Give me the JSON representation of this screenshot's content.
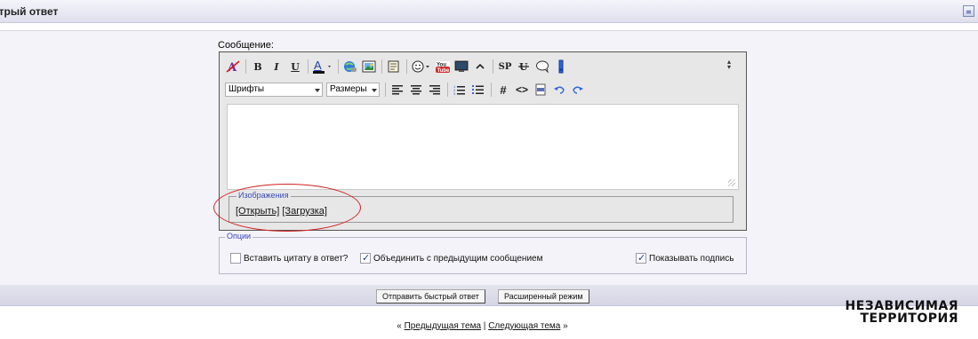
{
  "header": {
    "title": "стрый ответ"
  },
  "editor": {
    "message_label": "Сообщение:",
    "font_select": "Шрифты",
    "size_select": "Размеры",
    "toolbar_row1": [
      {
        "name": "remove-format-icon",
        "label": "A"
      },
      {
        "name": "bold-icon",
        "label": "B"
      },
      {
        "name": "italic-icon",
        "label": "I"
      },
      {
        "name": "underline-icon",
        "label": "U"
      },
      {
        "name": "text-color-icon",
        "label": "A"
      },
      {
        "name": "link-icon",
        "label": ""
      },
      {
        "name": "image-icon",
        "label": ""
      },
      {
        "name": "quote-icon",
        "label": ""
      },
      {
        "name": "smiley-icon",
        "label": "☺"
      },
      {
        "name": "youtube-icon",
        "label": "You"
      },
      {
        "name": "video-icon",
        "label": ""
      },
      {
        "name": "hide-icon",
        "label": "^"
      },
      {
        "name": "spoiler-icon",
        "label": "SP"
      },
      {
        "name": "strike-icon",
        "label": "U"
      },
      {
        "name": "bubble-icon",
        "label": "○"
      },
      {
        "name": "exclamation-icon",
        "label": "!"
      }
    ],
    "toolbar_row2_icons": [
      "align-left-icon",
      "align-center-icon",
      "align-right-icon",
      "ordered-list-icon",
      "unordered-list-icon",
      "hash-icon",
      "code-icon",
      "php-icon",
      "undo-icon",
      "redo-icon"
    ],
    "images_legend": "Изображения",
    "images_open": "[Открыть]",
    "images_upload": "[Загрузка]"
  },
  "options": {
    "legend": "Опции",
    "quote": {
      "label": "Вставить цитату в ответ?",
      "checked": false
    },
    "merge": {
      "label": "Объединить с предыдущим сообщением",
      "checked": true
    },
    "signature": {
      "label": "Показывать подпись",
      "checked": true
    }
  },
  "buttons": {
    "quick_reply": "Отправить быстрый ответ",
    "advanced": "Расширенный режим"
  },
  "nav": {
    "prev_prefix": "«",
    "prev": "Предыдущая тема",
    "separator": "|",
    "next": "Следующая тема",
    "next_suffix": "»"
  },
  "brand": {
    "line1": "НЕЗАВИСИМАЯ",
    "line2": "ТЕРРИТОРИЯ"
  },
  "colors": {
    "annotation": "#d32020",
    "legend_text": "#3a4ab8",
    "brand_red": "#c9161b"
  }
}
